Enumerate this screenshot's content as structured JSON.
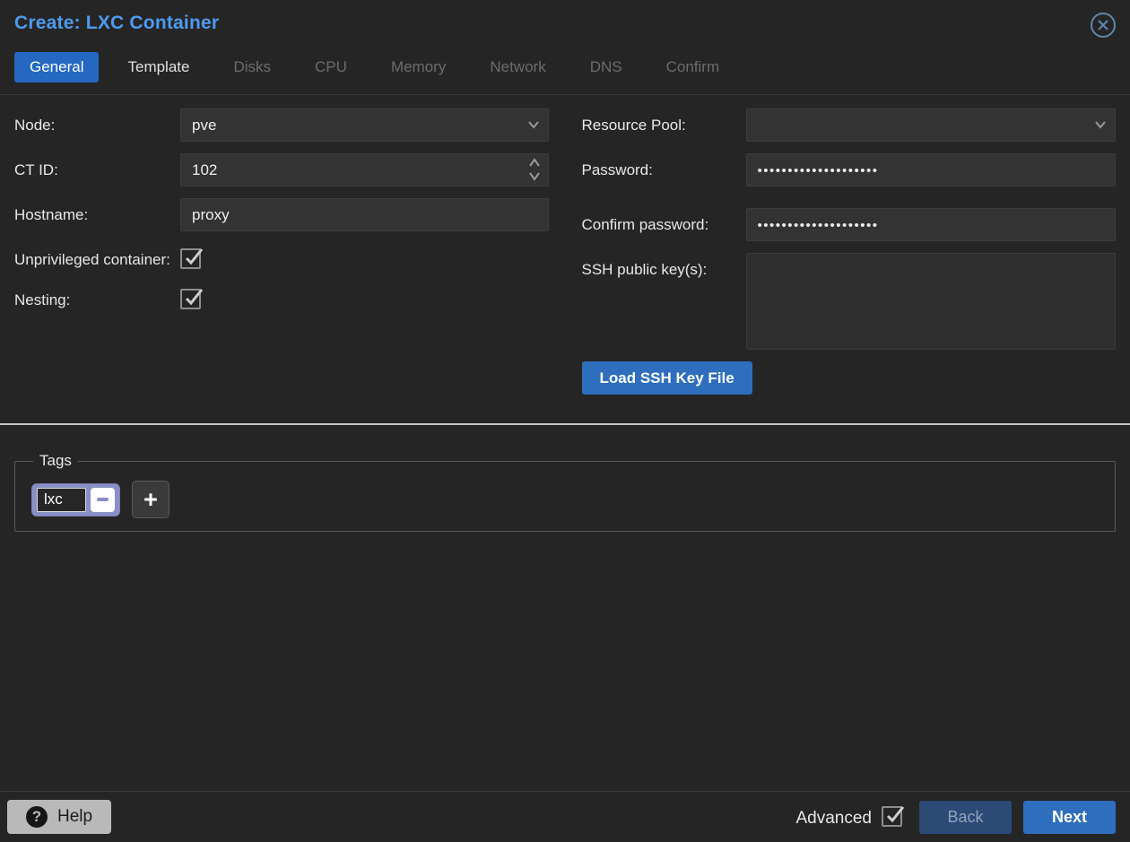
{
  "dialog": {
    "title": "Create: LXC Container"
  },
  "tabs": [
    {
      "label": "General",
      "state": "active"
    },
    {
      "label": "Template",
      "state": "enabled"
    },
    {
      "label": "Disks",
      "state": "disabled"
    },
    {
      "label": "CPU",
      "state": "disabled"
    },
    {
      "label": "Memory",
      "state": "disabled"
    },
    {
      "label": "Network",
      "state": "disabled"
    },
    {
      "label": "DNS",
      "state": "disabled"
    },
    {
      "label": "Confirm",
      "state": "disabled"
    }
  ],
  "form": {
    "left": {
      "node": {
        "label": "Node:",
        "value": "pve"
      },
      "ct_id": {
        "label": "CT ID:",
        "value": "102"
      },
      "hostname": {
        "label": "Hostname:",
        "value": "proxy"
      },
      "unprivileged": {
        "label": "Unprivileged container:",
        "checked": true
      },
      "nesting": {
        "label": "Nesting:",
        "checked": true
      }
    },
    "right": {
      "resource_pool": {
        "label": "Resource Pool:",
        "value": ""
      },
      "password": {
        "label": "Password:",
        "value": "••••••••••••••••••••"
      },
      "confirm_password": {
        "label": "Confirm password:",
        "value": "••••••••••••••••••••"
      },
      "ssh_keys": {
        "label": "SSH public key(s):",
        "value": ""
      },
      "load_ssh_button_label": "Load SSH Key File"
    }
  },
  "tags": {
    "legend": "Tags",
    "items": [
      {
        "value": "lxc"
      }
    ]
  },
  "footer": {
    "help_label": "Help",
    "help_icon_glyph": "?",
    "advanced_label": "Advanced",
    "advanced_checked": true,
    "back_label": "Back",
    "next_label": "Next"
  },
  "colors": {
    "background": "#252525",
    "title_blue": "#4c9bf0",
    "active_tab_blue": "#2468c2",
    "button_blue": "#2e6ebd",
    "field_background": "#333333",
    "tag_pill_purple": "#8a8fc5",
    "help_button_gray": "#b9b9b9",
    "divider_gray": "#c3c3c3"
  }
}
